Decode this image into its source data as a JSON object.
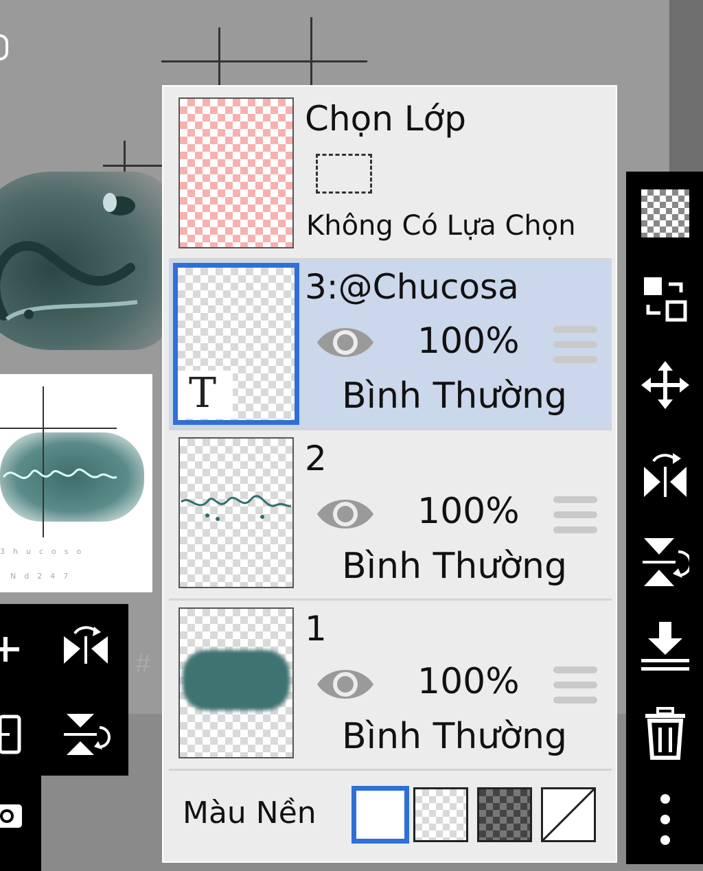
{
  "layers_panel": {
    "selection_layer": {
      "title": "Chọn Lớp",
      "status": "Không Có Lựa Chọn"
    },
    "layers": [
      {
        "name": "3:@Chucosa",
        "opacity": "100%",
        "blend_mode": "Bình Thường",
        "selected": true,
        "thumb_badge": "T"
      },
      {
        "name": "2",
        "opacity": "100%",
        "blend_mode": "Bình Thường",
        "selected": false
      },
      {
        "name": "1",
        "opacity": "100%",
        "blend_mode": "Bình Thường",
        "selected": false
      }
    ],
    "background": {
      "label": "Màu Nền",
      "options": [
        "white",
        "transparent-light",
        "transparent-dark",
        "none"
      ],
      "selected": "white"
    }
  },
  "right_toolbar": {
    "icons": [
      "transparency-checker-icon",
      "swap-layer-icon",
      "move-icon",
      "flip-horizontal-icon",
      "flip-vertical-icon",
      "merge-down-icon",
      "trash-icon",
      "more-vert-icon"
    ]
  },
  "left_toolbar": {
    "icons": [
      "add-layer-icon",
      "flip-horizontal-icon",
      "duplicate-layer-icon",
      "flip-vertical-icon",
      "camera-icon"
    ]
  },
  "colors": {
    "accent": "#2f6fd6",
    "selected_row": "#cbd7ea",
    "panel_bg": "#ececec",
    "toolbar_bg": "#000000"
  }
}
